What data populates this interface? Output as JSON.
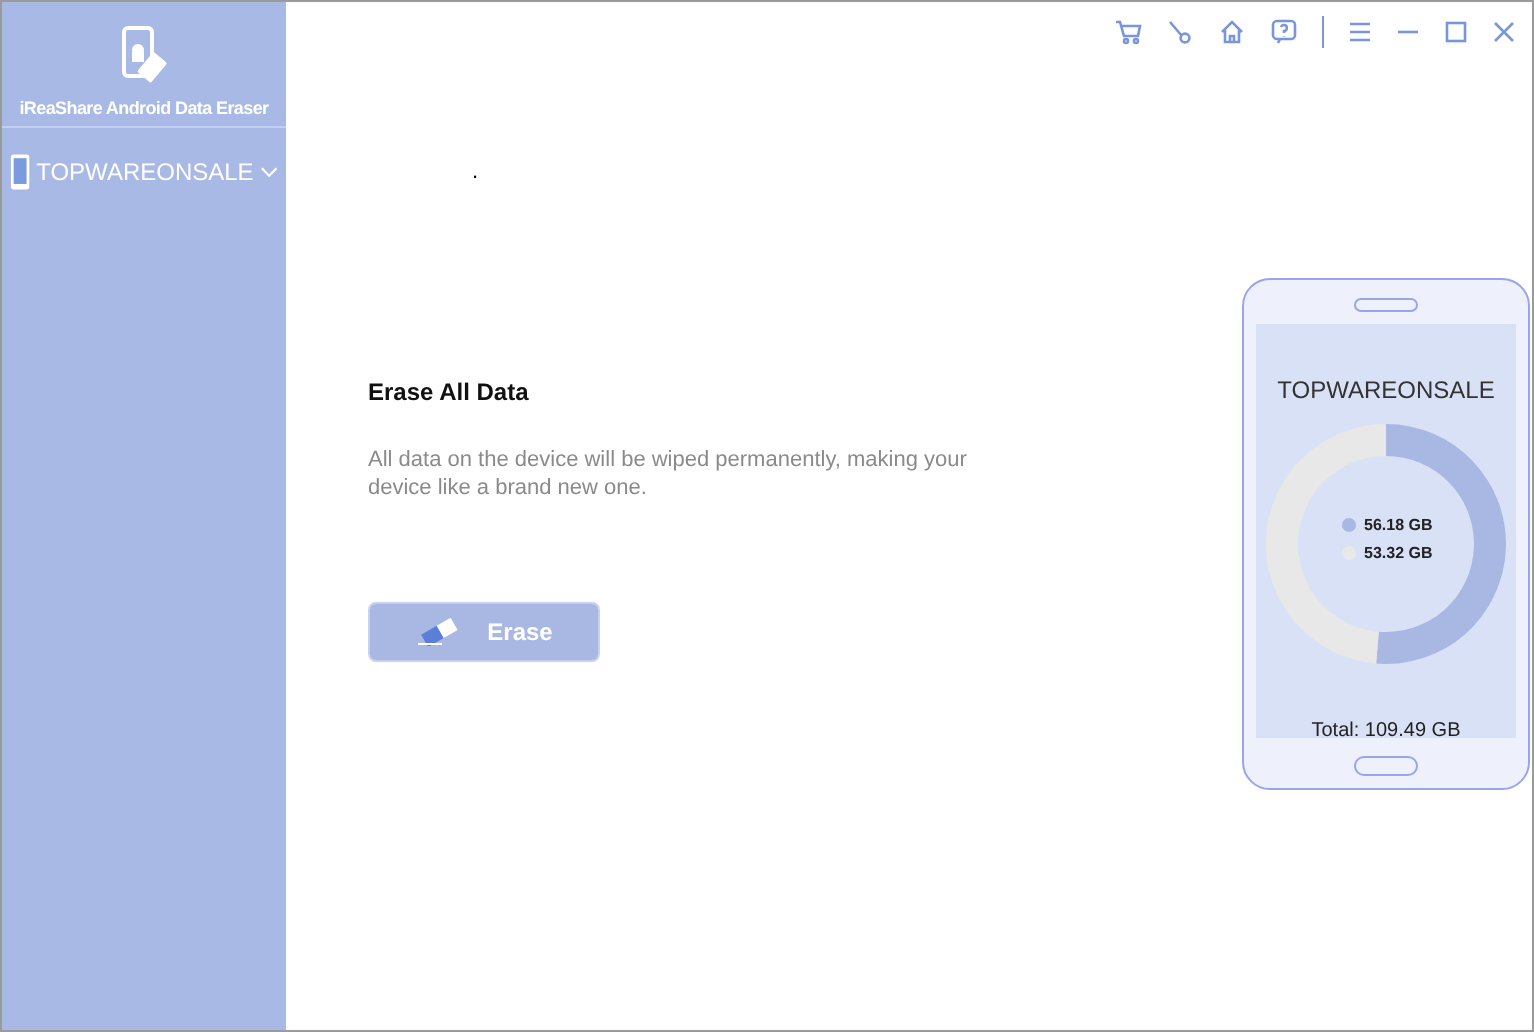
{
  "app": {
    "title": "iReaShare Android Data Eraser"
  },
  "device_selector": {
    "label": "TOPWAREONSALE",
    "expanded": false
  },
  "main": {
    "heading": "Erase All Data",
    "description": "All data on the device will be wiped permanently, making your device like a brand new one.",
    "dot": ".",
    "button": {
      "label": "Erase",
      "disabled": true
    }
  },
  "phone": {
    "device_name": "TOPWAREONSALE",
    "total": "Total: 109.49 GB",
    "chart_data": {
      "type": "donut",
      "legend": "center",
      "categories": [
        "56.18 GB",
        "53.32 GB"
      ],
      "colors": [
        "#a8b8e3",
        "#e8e8e8"
      ],
      "series": [
        {
          "values": [
            56.18,
            53.32
          ]
        }
      ]
    }
  }
}
